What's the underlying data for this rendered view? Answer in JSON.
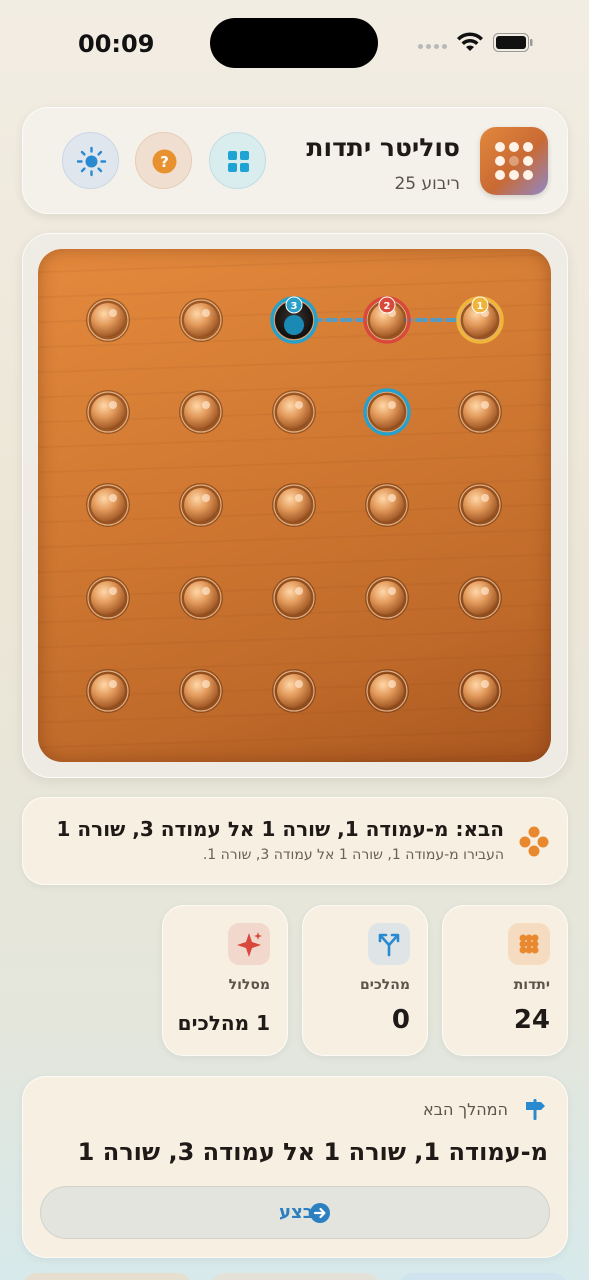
{
  "status_bar": {
    "time": "00:09"
  },
  "header": {
    "title": "סוליטר יתדות",
    "subtitle": "ריבוע 25",
    "buttons": [
      {
        "name": "grid",
        "icon": "grid-icon"
      },
      {
        "name": "help",
        "icon": "question-icon",
        "glyph": "?"
      },
      {
        "name": "theme",
        "icon": "sun-icon"
      }
    ]
  },
  "board": {
    "rows": 5,
    "cols": 5,
    "cells": [
      [
        "peg-hint-1",
        "peg-hint-2",
        "empty-hint-3",
        "peg",
        "peg"
      ],
      [
        "peg",
        "peg-selected",
        "peg",
        "peg",
        "peg"
      ],
      [
        "peg",
        "peg",
        "peg",
        "peg",
        "peg"
      ],
      [
        "peg",
        "peg",
        "peg",
        "peg",
        "peg"
      ],
      [
        "peg",
        "peg",
        "peg",
        "peg",
        "peg"
      ]
    ],
    "hint_badges": [
      "1",
      "2",
      "3"
    ],
    "colors": {
      "hint1": "#f0b43a",
      "hint2": "#d9493b",
      "hint3": "#2aa0c8",
      "path": "#4b9fd0"
    }
  },
  "next_info": {
    "title": "הבא: מ-עמודה 1, שורה 1 אל עמודה 3, שורה 1",
    "subtitle": "העבירו מ-עמודה 1, שורה 1 אל עמודה 3, שורה 1."
  },
  "stats": {
    "pegs": {
      "label": "יתדות",
      "value": "24",
      "icon": "pegs-icon"
    },
    "moves": {
      "label": "מהלכים",
      "value": "0",
      "icon": "fork-icon"
    },
    "path": {
      "label": "מסלול",
      "value": "1 מהלכים",
      "icon": "sparkle-icon"
    }
  },
  "next_move": {
    "header": "המהלך הבא",
    "text": "מ-עמודה 1, שורה 1 אל עמודה 3, שורה 1",
    "button_label": "בצע"
  }
}
